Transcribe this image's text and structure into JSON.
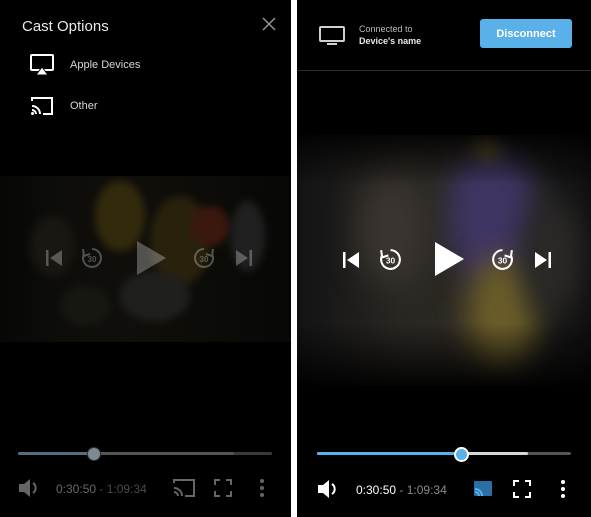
{
  "left_panel": {
    "title": "Cast Options",
    "options": [
      {
        "label": "Apple Devices",
        "icon": "airplay-icon"
      },
      {
        "label": "Other",
        "icon": "chromecast-icon"
      }
    ],
    "player": {
      "current_time": "0:30:50",
      "separator_duration": " - 1:09:34",
      "progress": 0.3,
      "buffered": 0.85
    }
  },
  "right_panel": {
    "connection": {
      "status": "Connected to",
      "device": "Device's name"
    },
    "disconnect_label": "Disconnect",
    "player": {
      "current_time": "0:30:50",
      "separator_duration": " - 1:09:34",
      "progress": 0.57,
      "buffered": 0.83
    }
  },
  "colors": {
    "accent": "#5ab0e8",
    "seek_track": "#555555",
    "background": "#000000"
  }
}
